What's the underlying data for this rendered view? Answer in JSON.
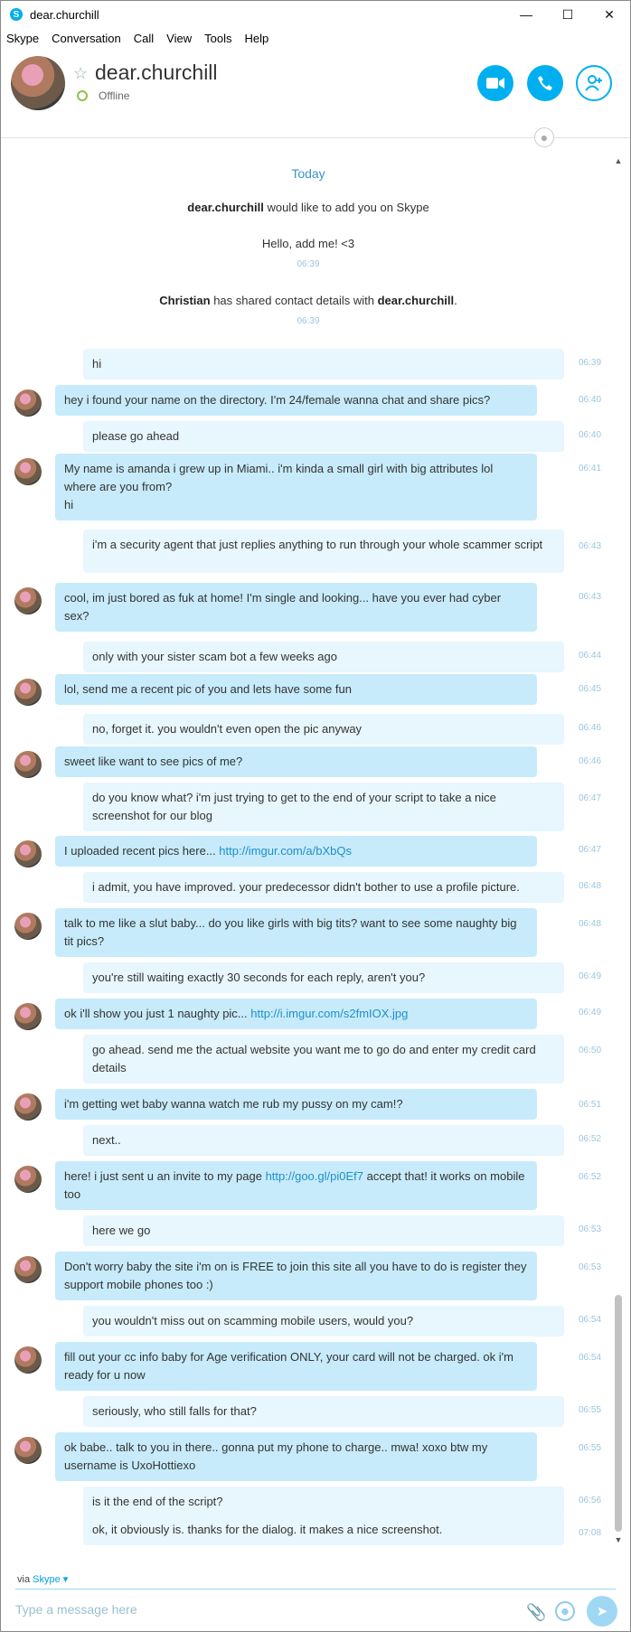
{
  "window": {
    "title": "dear.churchill"
  },
  "menu": [
    "Skype",
    "Conversation",
    "Call",
    "View",
    "Tools",
    "Help"
  ],
  "contact": {
    "name": "dear.churchill",
    "status": "Offline"
  },
  "day_label": "Today",
  "system": {
    "add_name": "dear.churchill",
    "add_text": " would like to add you on Skype",
    "greeting": "Hello, add me! <3",
    "greeting_time": "06:39",
    "shared_name": "Christian",
    "shared_text": " has shared contact details with ",
    "shared_target": "dear.churchill",
    "shared_end": ".",
    "shared_time": "06:39"
  },
  "messages": [
    {
      "dir": "out",
      "text": "hi",
      "time": "06:39"
    },
    {
      "dir": "in",
      "text": "hey i found your name on the directory. I'm 24/female wanna chat and share pics?",
      "time": "06:40"
    },
    {
      "dir": "out",
      "text": "please go ahead",
      "time": "06:40"
    },
    {
      "dir": "in",
      "text": "My name is amanda i grew up in Miami.. i'm kinda a small girl with big attributes lol where are you from?\nhi",
      "time": "06:41"
    },
    {
      "dir": "out",
      "text": "i'm a security agent that just replies anything to run through your whole scammer script",
      "time": "06:43"
    },
    {
      "dir": "in",
      "text": "cool, im just bored as fuk at home! I'm single and looking... have you ever had cyber sex?",
      "time": "06:43"
    },
    {
      "dir": "out",
      "text": "only with your sister scam bot a few weeks ago",
      "time": "06:44"
    },
    {
      "dir": "in",
      "text": "lol, send me a recent pic of you and lets have some fun",
      "time": "06:45"
    },
    {
      "dir": "out",
      "text": "no, forget it. you wouldn't even open the pic anyway",
      "time": "06:46"
    },
    {
      "dir": "in",
      "text": "sweet like want to see pics of me?",
      "time": "06:46"
    },
    {
      "dir": "out",
      "text": "do you know what? i'm just trying to get to the end of your script to take a nice screenshot for our blog",
      "time": "06:47"
    },
    {
      "dir": "in",
      "text": "I uploaded recent pics here... ",
      "link": "http://imgur.com/a/bXbQs",
      "time": "06:47"
    },
    {
      "dir": "out",
      "text": "i admit, you have improved. your predecessor didn't bother to use a profile picture.",
      "time": "06:48"
    },
    {
      "dir": "in",
      "text": "talk to me like a slut baby... do you like girls with big tits? want to see some naughty big tit pics?",
      "time": "06:48"
    },
    {
      "dir": "out",
      "text": "you're still waiting exactly 30 seconds for each reply, aren't you?",
      "time": "06:49"
    },
    {
      "dir": "in",
      "text": "ok i'll show you just 1 naughty pic... ",
      "link": "http://i.imgur.com/s2fmIOX.jpg",
      "time": "06:49"
    },
    {
      "dir": "out",
      "text": "go ahead. send me the actual website you want me to go do and enter my credit card details",
      "time": "06:50"
    },
    {
      "dir": "in",
      "text": "i'm getting wet baby wanna watch me rub my pussy on my cam!?",
      "time": "06:51"
    },
    {
      "dir": "out",
      "text": "next..",
      "time": "06:52"
    },
    {
      "dir": "in",
      "text": "here! i just sent u an invite to my page ",
      "link": "http://goo.gl/pi0Ef7",
      "after": " accept that! it works on mobile too",
      "time": "06:52"
    },
    {
      "dir": "out",
      "text": "here we go",
      "time": "06:53"
    },
    {
      "dir": "in",
      "text": "Don't worry baby the site i'm on is FREE to join this site all you have to do is register they support mobile phones too :)",
      "time": "06:53"
    },
    {
      "dir": "out",
      "text": "you wouldn't miss out on scamming mobile users, would you?",
      "time": "06:54"
    },
    {
      "dir": "in",
      "text": "fill out your cc info baby for Age verification ONLY, your card will not be charged. ok i'm ready for u now",
      "time": "06:54"
    },
    {
      "dir": "out",
      "text": "seriously, who still falls for that?",
      "time": "06:55"
    },
    {
      "dir": "in",
      "text": "ok babe.. talk to you in there.. gonna put my phone to charge.. mwa! xoxo btw my username is UxoHottiexo",
      "time": "06:55"
    },
    {
      "dir": "out",
      "text": "is it the end of the script?",
      "time": "06:56"
    },
    {
      "dir": "out",
      "text": "ok, it obviously is. thanks for the dialog. it makes a nice screenshot.",
      "time": "07:08"
    }
  ],
  "footer": {
    "via": "via",
    "via_app": "Skype ▾",
    "placeholder": "Type a message here"
  },
  "colors": {
    "accent": "#00aff0",
    "bubble_in": "#c7ebfb",
    "bubble_out": "#e8f6fd"
  }
}
